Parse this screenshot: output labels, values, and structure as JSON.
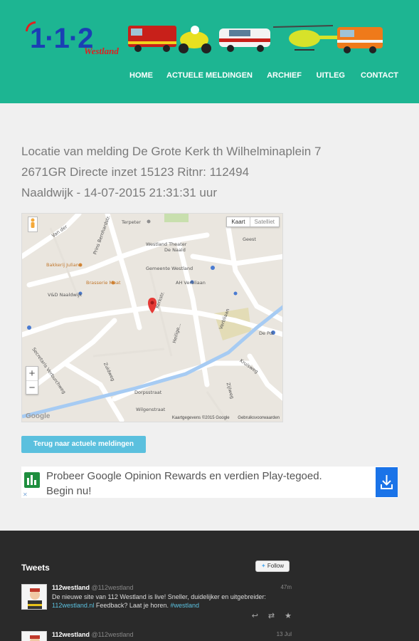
{
  "header": {
    "logo_number": "1·1·2",
    "logo_region": "Westland",
    "nav": [
      "HOME",
      "ACTUELE MELDINGEN",
      "ARCHIEF",
      "UITLEG",
      "CONTACT"
    ]
  },
  "melding": {
    "title_line1": "Locatie van melding De Grote Kerk th Wilhelminaplein 7",
    "title_line2": "2671GR Directe inzet 15123 Ritnr: 112494",
    "title_line3": "Naaldwijk - 14-07-2015 21:31:31 uur"
  },
  "map": {
    "type_map": "Kaart",
    "type_satellite": "Satelliet",
    "zoom_in": "+",
    "zoom_out": "−",
    "google": "Google",
    "attribution": "Kaartgegevens ©2015 Google",
    "terms": "Gebruiksvoorwaarden",
    "labels": {
      "terpeter": "Terpeter",
      "theater": "Westland Theater",
      "de_naald": "De Naald",
      "gemeente": "Gemeente Westland",
      "bakkerij": "Bakkerij Juliana",
      "brasserie": "Brasserie Meat",
      "vd": "V&D Naaldwijk",
      "ah": "AH Verbliaan",
      "kerkstr": "Kerkstr.",
      "verbliaan": "Verbliaan",
      "heilige": "Heilige...",
      "zuidweg": "Zuidweg",
      "secretaris": "Secretaris Verburchweg",
      "dorpsstraat": "Dorpsstraat",
      "zijlweg": "Zijlweg",
      "de_pol": "De Pol",
      "kruisweg": "Kruisweg",
      "geest": "Geest",
      "van_der": "Van der",
      "wilgenstraat": "Wilgenstraat",
      "prins": "Prins Bernhardstr."
    }
  },
  "back_button": "Terug naar actuele meldingen",
  "ad": {
    "text": "Probeer Google Opinion Rewards en verdien Play-tegoed. Begin nu!",
    "close": "✕",
    "download_icon": "download-icon"
  },
  "footer": {
    "tweets_title": "Tweets",
    "follow_label": "Follow",
    "tweets": [
      {
        "name": "112westland",
        "handle": "@112westland",
        "time": "47m",
        "text_pre": "De nieuwe site van 112 Westland is live! Sneller, duidelijker en uitgebreider: ",
        "link": "112westland.nl",
        "text_mid": " Feedback? Laat je horen. ",
        "hashtag": "#westland"
      },
      {
        "name": "112westland",
        "handle": "@112westland",
        "time": "13 Jul"
      }
    ]
  }
}
